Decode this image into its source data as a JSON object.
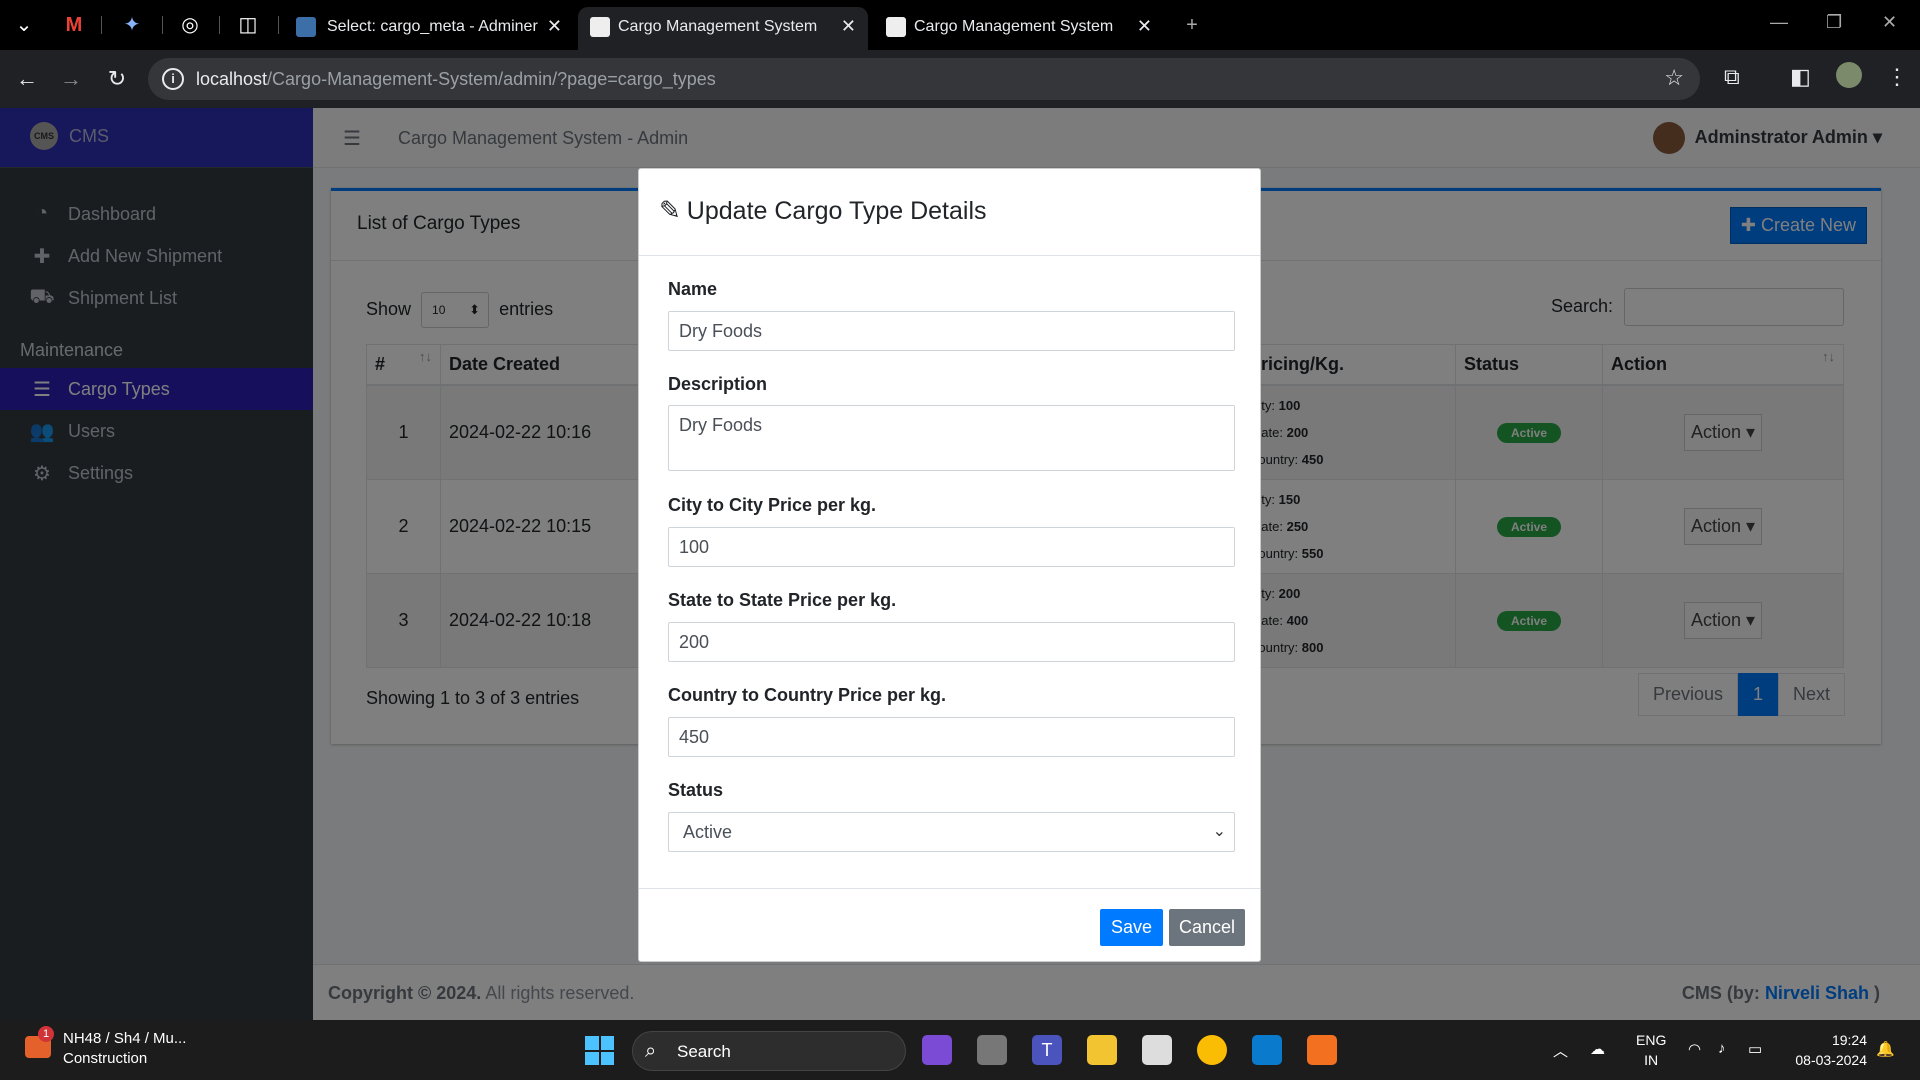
{
  "browser": {
    "tabs": [
      {
        "title": "Select: cargo_meta - Adminer"
      },
      {
        "title": "Cargo Management System"
      },
      {
        "title": "Cargo Management System"
      }
    ],
    "url_host": "localhost",
    "url_path": "/Cargo-Management-System/admin/?page=cargo_types"
  },
  "sidebar": {
    "brand": "CMS",
    "items": [
      {
        "label": "Dashboard",
        "icon": "dashboard-icon"
      },
      {
        "label": "Add New Shipment",
        "icon": "plus-icon"
      },
      {
        "label": "Shipment List",
        "icon": "truck-icon"
      }
    ],
    "section_header": "Maintenance",
    "maintenance": [
      {
        "label": "Cargo Types",
        "icon": "table-icon"
      },
      {
        "label": "Users",
        "icon": "users-icon"
      },
      {
        "label": "Settings",
        "icon": "cogs-icon"
      }
    ]
  },
  "topnav": {
    "title": "Cargo Management System - Admin",
    "user": "Adminstrator Admin"
  },
  "card": {
    "title": "List of Cargo Types",
    "create_label": "Create New",
    "show_label": "Show",
    "entries_value": "10",
    "entries_label": "entries",
    "search_label": "Search:"
  },
  "table": {
    "headers": [
      "#",
      "Date Created",
      "Pricing/Kg.",
      "Status",
      "Action"
    ],
    "rows": [
      {
        "num": "1",
        "date": "2024-02-22 10:16",
        "city": "100",
        "state": "200",
        "country": "450",
        "status": "Active",
        "action": "Action"
      },
      {
        "num": "2",
        "date": "2024-02-22 10:15",
        "city": "150",
        "state": "250",
        "country": "550",
        "status": "Active",
        "action": "Action"
      },
      {
        "num": "3",
        "date": "2024-02-22 10:18",
        "city": "200",
        "state": "400",
        "country": "800",
        "status": "Active",
        "action": "Action"
      }
    ],
    "price_labels": {
      "city": "City:",
      "state": "State:",
      "country": "Country:"
    },
    "info": "Showing 1 to 3 of 3 entries",
    "pager": {
      "prev": "Previous",
      "page": "1",
      "next": "Next"
    }
  },
  "footer": {
    "copyright": "Copyright © 2024.",
    "rights": "All rights reserved.",
    "credit": "CMS (by:",
    "author": "Nirveli Shah",
    "close": ")"
  },
  "modal": {
    "title": "Update Cargo Type Details",
    "name_label": "Name",
    "name_value": "Dry Foods",
    "desc_label": "Description",
    "desc_value": "Dry Foods",
    "city_label": "City to City Price per kg.",
    "city_value": "100",
    "state_label": "State to State Price per kg.",
    "state_value": "200",
    "country_label": "Country to Country Price per kg.",
    "country_value": "450",
    "status_label": "Status",
    "status_value": "Active",
    "save_label": "Save",
    "cancel_label": "Cancel"
  },
  "taskbar": {
    "weather_title": "NH48 / Sh4 / Mu...",
    "weather_sub": "Construction",
    "weather_badge": "1",
    "search": "Search",
    "lang1": "ENG",
    "lang2": "IN",
    "time": "19:24",
    "date": "08-03-2024"
  },
  "colors": {
    "accent": "#007bff",
    "sidebar": "#343a40",
    "active_nav": "#2c20b8",
    "status_active": "#28a745"
  }
}
